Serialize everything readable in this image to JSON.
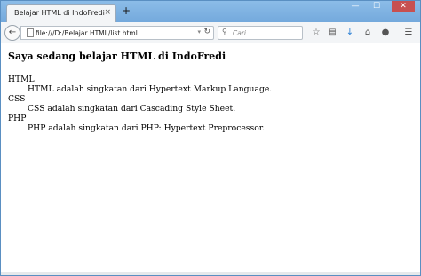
{
  "browser": {
    "tab_title": "Belajar HTML di IndoFredi",
    "tab_close": "×",
    "new_tab": "+",
    "url": "file:///D:/Belajar HTML/list.html",
    "search_placeholder": "Cari",
    "window_controls": [
      "—",
      "☐",
      "✕"
    ]
  },
  "page": {
    "heading": "Saya sedang belajar HTML di IndoFredi",
    "definitions": [
      {
        "term": "HTML",
        "desc": "HTML adalah singkatan dari Hypertext Markup Language."
      },
      {
        "term": "CSS",
        "desc": "CSS adalah singkatan dari Cascading Style Sheet."
      },
      {
        "term": "PHP",
        "desc": "PHP adalah singkatan dari PHP: Hypertext Preprocessor."
      }
    ]
  },
  "icons": {
    "back": "back-arrow-icon",
    "page": "page-icon",
    "reload": "reload-icon",
    "search": "magnifier-icon",
    "bookmark": "star-icon",
    "reading_list": "clipboard-icon",
    "download": "download-arrow-icon",
    "home": "home-icon",
    "chat": "chat-bubble-icon",
    "menu": "hamburger-menu-icon"
  }
}
